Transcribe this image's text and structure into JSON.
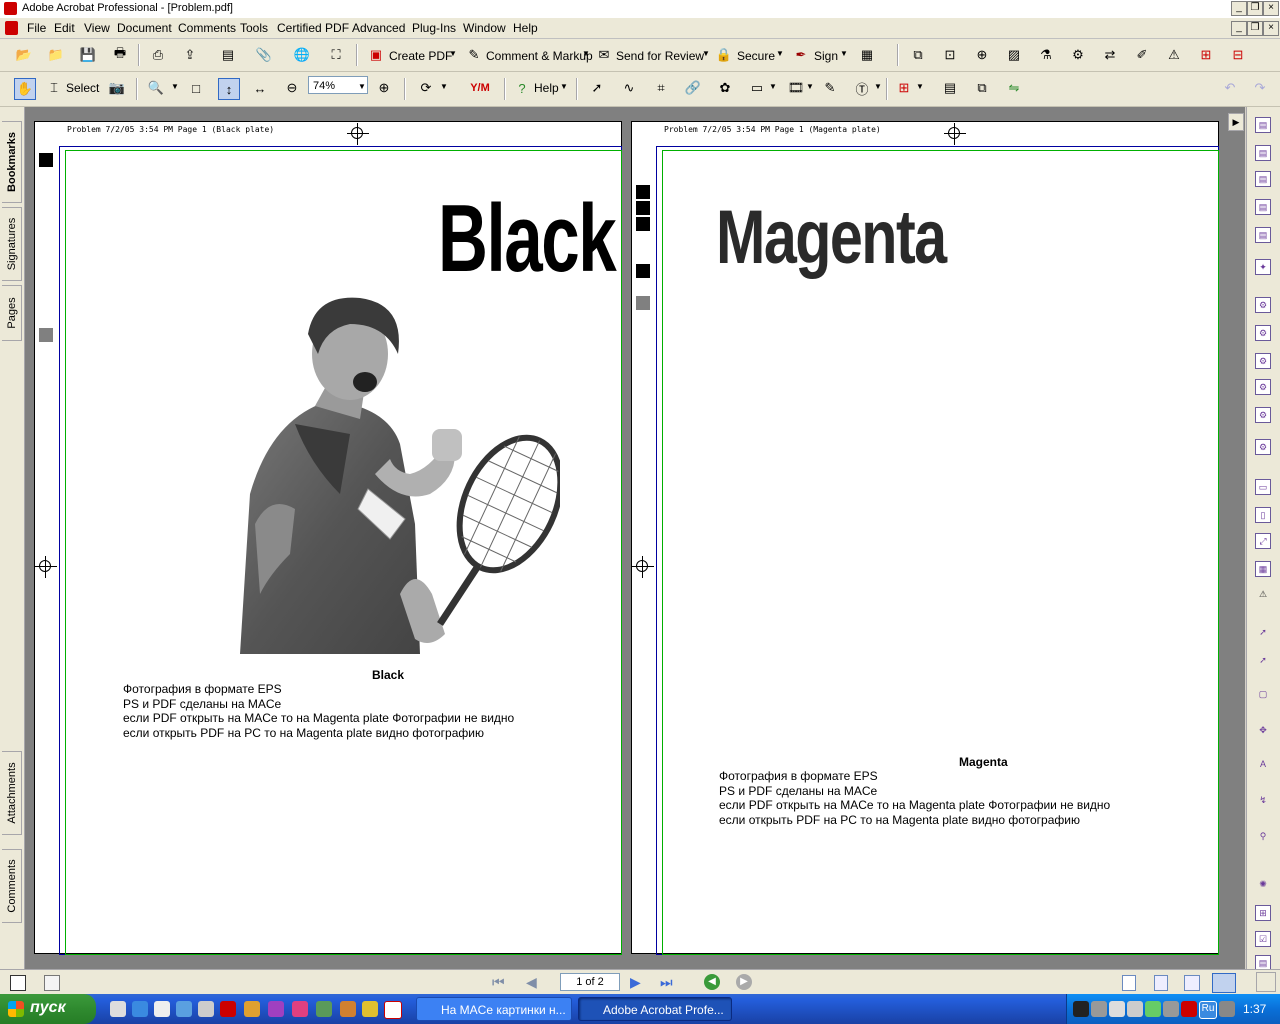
{
  "window": {
    "title": "Adobe Acrobat Professional - [Problem.pdf]"
  },
  "menu": [
    "File",
    "Edit",
    "View",
    "Document",
    "Comments",
    "Tools",
    "Certified PDF",
    "Advanced",
    "Plug-Ins",
    "Window",
    "Help"
  ],
  "toolbar1": {
    "create_pdf": "Create PDF",
    "comment_markup": "Comment & Markup",
    "send_review": "Send for Review",
    "secure": "Secure",
    "sign": "Sign"
  },
  "toolbar2": {
    "select": "Select",
    "zoom": "74%",
    "help": "Help"
  },
  "left_tabs": [
    "Bookmarks",
    "Signatures",
    "Pages",
    "Attachments",
    "Comments"
  ],
  "pages": [
    {
      "slug": "Problem  7/2/05 3:54 PM  Page 1   (Black plate)",
      "title": "Black",
      "caption_title": "Black",
      "caption_lines": [
        "Фотография в формате EPS",
        "PS и PDF сделаны на MACе",
        "если PDF открыть на MACе то на Magenta plate Фотографии не видно",
        "если открыть PDF на PC то на Magenta plate видно фотографию"
      ]
    },
    {
      "slug": "Problem  7/2/05 3:54 PM  Page 1   (Magenta plate)",
      "title": "Magenta",
      "caption_title": "Magenta",
      "caption_lines": [
        "Фотография в формате EPS",
        "PS и PDF сделаны на MACе",
        "если PDF открыть на MACе то на Magenta plate Фотографии не видно",
        "если открыть PDF на PC то на Magenta plate видно фотографию"
      ]
    }
  ],
  "status": {
    "page_indicator": "1 of 2"
  },
  "taskbar": {
    "start": "пуск",
    "task1": "На MACе картинки н...",
    "task2": "Adobe Acrobat Profe...",
    "lang": "Ru",
    "clock": "1:37"
  },
  "colors": {
    "trim_green": "#00b000",
    "trim_blue": "#0000a0",
    "taskbar_blue": "#245edb"
  }
}
